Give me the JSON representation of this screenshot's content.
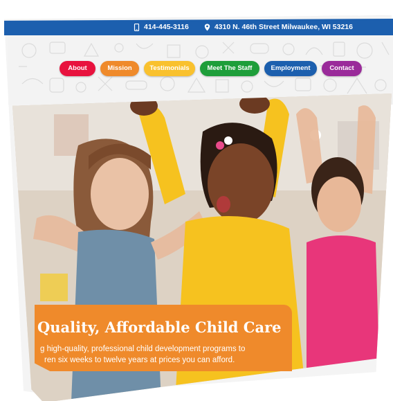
{
  "topbar": {
    "phone": "414-445-3116",
    "address": "4310 N. 46th Street Milwaukee, WI 53216",
    "icons": [
      "phone-icon",
      "location-pin-icon"
    ]
  },
  "nav": {
    "items": [
      {
        "label": "About",
        "color": "#e8123e"
      },
      {
        "label": "Mission",
        "color": "#ef8a2b"
      },
      {
        "label": "Testimonials",
        "color": "#f9c12e"
      },
      {
        "label": "Meet The Staff",
        "color": "#1e9e3a"
      },
      {
        "label": "Employment",
        "color": "#1c5fae"
      },
      {
        "label": "Contact",
        "color": "#9a2b9a"
      }
    ]
  },
  "hero": {
    "title": "Quality, Affordable Child Care",
    "text": "g high-quality, professional child development programs to ren six weeks to twelve years at prices you can afford.",
    "text_line1": "g high-quality, professional child development programs to",
    "text_line2": "ren six weeks to twelve years at prices you can afford."
  },
  "colors": {
    "topbar": "#1c5fae",
    "banner": "#ef8a2b",
    "header_bg": "#f3f3f3"
  }
}
